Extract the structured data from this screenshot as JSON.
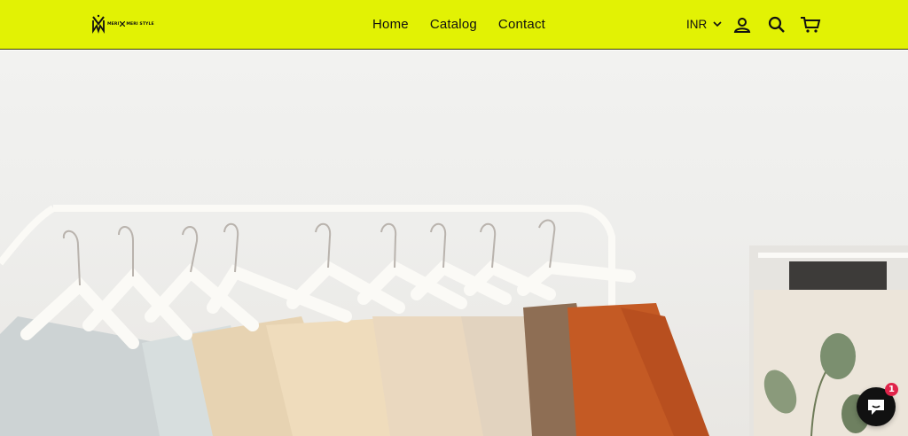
{
  "header": {
    "logo_alt": "MERI MERI STYLE",
    "logo_left": "MERI",
    "logo_right": "MERI STYLE",
    "background": "#e2f204"
  },
  "nav": [
    {
      "label": "Home"
    },
    {
      "label": "Catalog"
    },
    {
      "label": "Contact"
    }
  ],
  "currency": {
    "value": "INR"
  },
  "icons": {
    "account": "account-icon",
    "search": "search-icon",
    "cart": "cart-icon",
    "chat": "chat-icon"
  },
  "chat": {
    "badge": "1"
  }
}
